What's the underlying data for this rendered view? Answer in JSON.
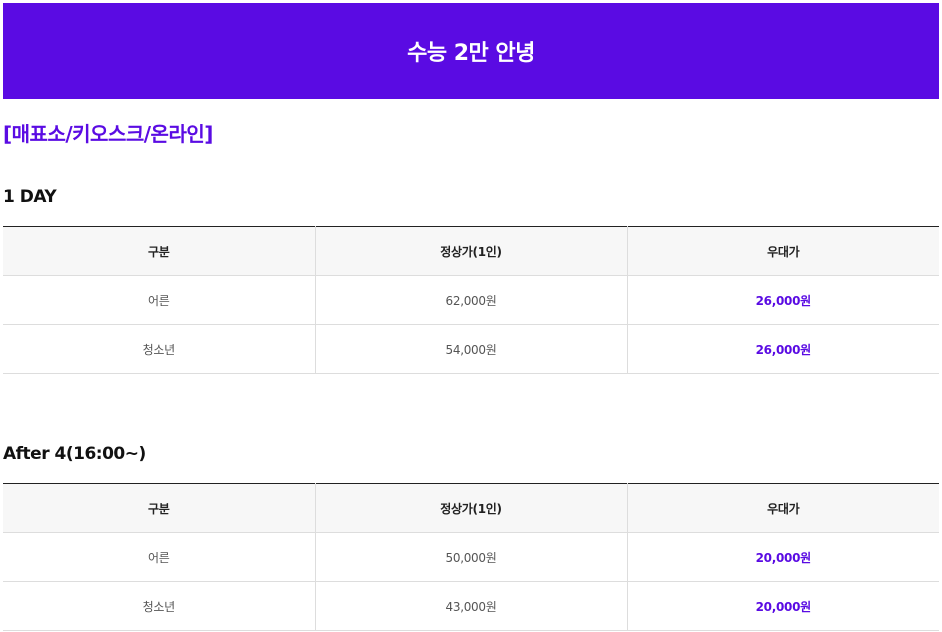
{
  "banner": {
    "title": "수능 2만 안녕"
  },
  "channels_heading": "[매표소/키오스크/온라인]",
  "colors": {
    "accent": "#5a0be3"
  },
  "sections": [
    {
      "title": "1 DAY",
      "headers": [
        "구분",
        "정상가(1인)",
        "우대가"
      ],
      "rows": [
        {
          "category": "어른",
          "regular": "62,000원",
          "discount": "26,000원"
        },
        {
          "category": "청소년",
          "regular": "54,000원",
          "discount": "26,000원"
        }
      ]
    },
    {
      "title": "After 4(16:00~)",
      "headers": [
        "구분",
        "정상가(1인)",
        "우대가"
      ],
      "rows": [
        {
          "category": "어른",
          "regular": "50,000원",
          "discount": "20,000원"
        },
        {
          "category": "청소년",
          "regular": "43,000원",
          "discount": "20,000원"
        }
      ]
    }
  ]
}
